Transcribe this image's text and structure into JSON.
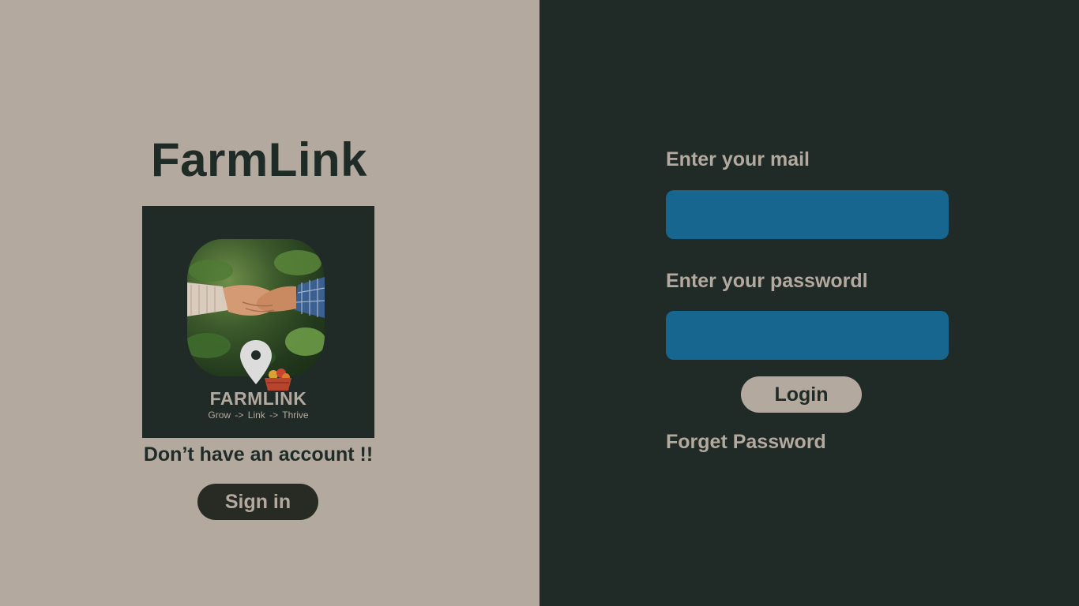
{
  "brand": {
    "title": "FarmLink",
    "logo_name": "FARMLINK",
    "logo_tagline": "Grow -> Link -> Thrive",
    "logo_icons": [
      "handshake-photo",
      "location-pin-icon",
      "produce-crate-icon"
    ]
  },
  "signup": {
    "prompt": "Don’t have an account !!",
    "button_label": "Sign in"
  },
  "login": {
    "email_label": "Enter your mail",
    "email_value": "",
    "password_label": "Enter your passwordl",
    "password_value": "",
    "button_label": "Login",
    "forgot_label": "Forget Password"
  },
  "colors": {
    "left_panel": "#b3a99e",
    "right_panel": "#202a27",
    "input_bg": "#17668f",
    "signin_button": "#282b23",
    "login_button": "#b3a99e"
  }
}
